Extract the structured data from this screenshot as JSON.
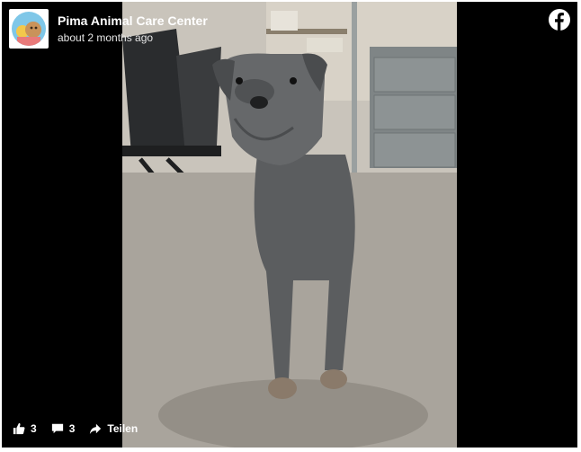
{
  "post": {
    "page_name": "Pima Animal Care Center",
    "timestamp": "about 2 months ago",
    "photo_icon": "dog-photo"
  },
  "brand": {
    "logo_icon": "facebook-logo-icon",
    "color": "#ffffff"
  },
  "footer": {
    "likes_count": "3",
    "comments_count": "3",
    "share_label": "Teilen"
  }
}
